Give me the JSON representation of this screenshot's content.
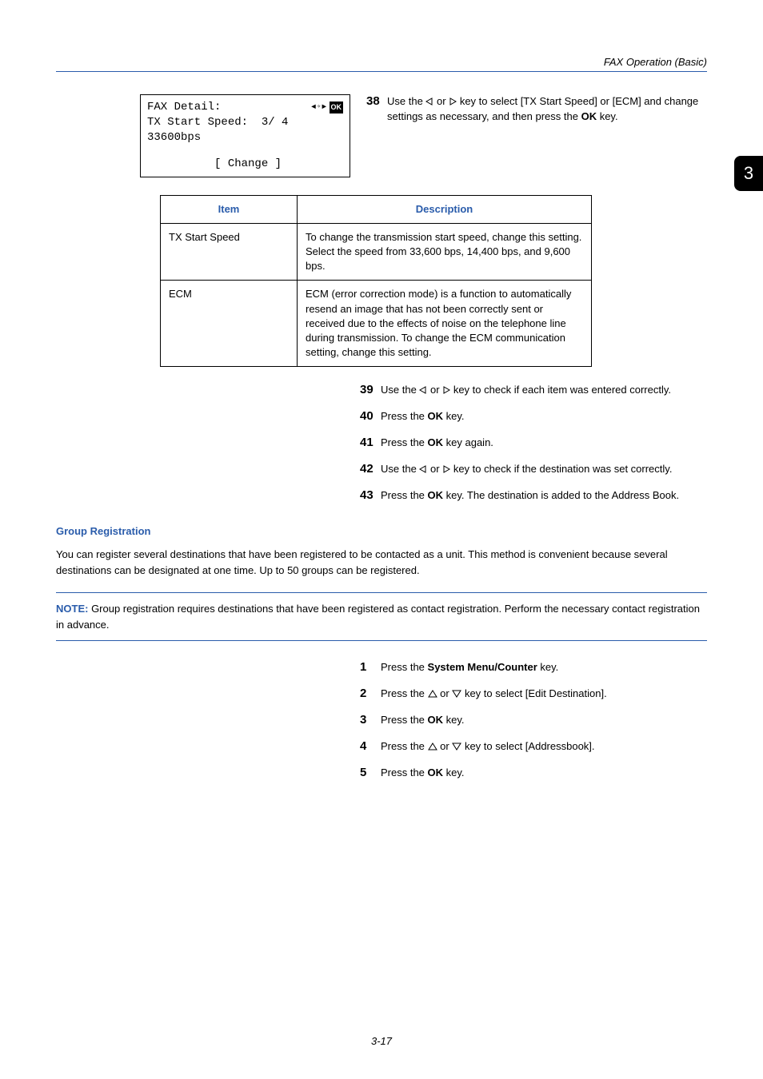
{
  "header": {
    "title": "FAX Operation (Basic)"
  },
  "sideTab": "3",
  "lcd": {
    "line1_left": "FAX Detail:",
    "line1_ok": "OK",
    "line2": "TX Start Speed:  3/ 4",
    "line3": "33600bps",
    "line4": "          [ Change ]"
  },
  "step38": {
    "num": "38",
    "text_a": "Use the ",
    "text_b": " or ",
    "text_c": " key to select [TX Start Speed] or [ECM] and change settings as necessary, and then press the ",
    "ok": "OK",
    "text_d": " key."
  },
  "table": {
    "h1": "Item",
    "h2": "Description",
    "rows": [
      {
        "item": "TX Start Speed",
        "desc": "To change the transmission start speed, change this setting. Select the speed from 33,600 bps, 14,400 bps, and 9,600 bps."
      },
      {
        "item": "ECM",
        "desc": "ECM (error correction mode) is a function to automatically resend an image that has not been correctly sent or received due to the effects of noise on the telephone line during transmission. To change the ECM communication setting, change this setting."
      }
    ]
  },
  "steps": {
    "s39": {
      "num": "39",
      "a": "Use the ",
      "b": " or ",
      "c": " key to check if each item was entered correctly."
    },
    "s40": {
      "num": "40",
      "a": "Press the ",
      "ok": "OK",
      "b": " key."
    },
    "s41": {
      "num": "41",
      "a": "Press the ",
      "ok": "OK",
      "b": " key again."
    },
    "s42": {
      "num": "42",
      "a": "Use the ",
      "b": " or ",
      "c": " key to check if the destination was set correctly."
    },
    "s43": {
      "num": "43",
      "a": "Press the ",
      "ok": "OK",
      "b": " key. The destination is added to the Address Book."
    }
  },
  "group": {
    "heading": "Group Registration",
    "para": "You can register several destinations that have been registered to be contacted as a unit. This method is convenient because several destinations can be designated at one time. Up to 50 groups can be registered."
  },
  "note": {
    "label": "NOTE:",
    "text": " Group registration requires destinations that have been registered as contact registration. Perform the necessary contact registration in advance."
  },
  "steps2": {
    "s1": {
      "num": "1",
      "a": "Press the ",
      "b": "System Menu/Counter",
      "c": " key."
    },
    "s2": {
      "num": "2",
      "a": "Press the ",
      "b": " or ",
      "c": " key to select [Edit Destination]."
    },
    "s3": {
      "num": "3",
      "a": "Press the ",
      "ok": "OK",
      "b": " key."
    },
    "s4": {
      "num": "4",
      "a": "Press the ",
      "b": " or ",
      "c": " key to select [Addressbook]."
    },
    "s5": {
      "num": "5",
      "a": "Press the ",
      "ok": "OK",
      "b": " key."
    }
  },
  "footer": "3-17"
}
